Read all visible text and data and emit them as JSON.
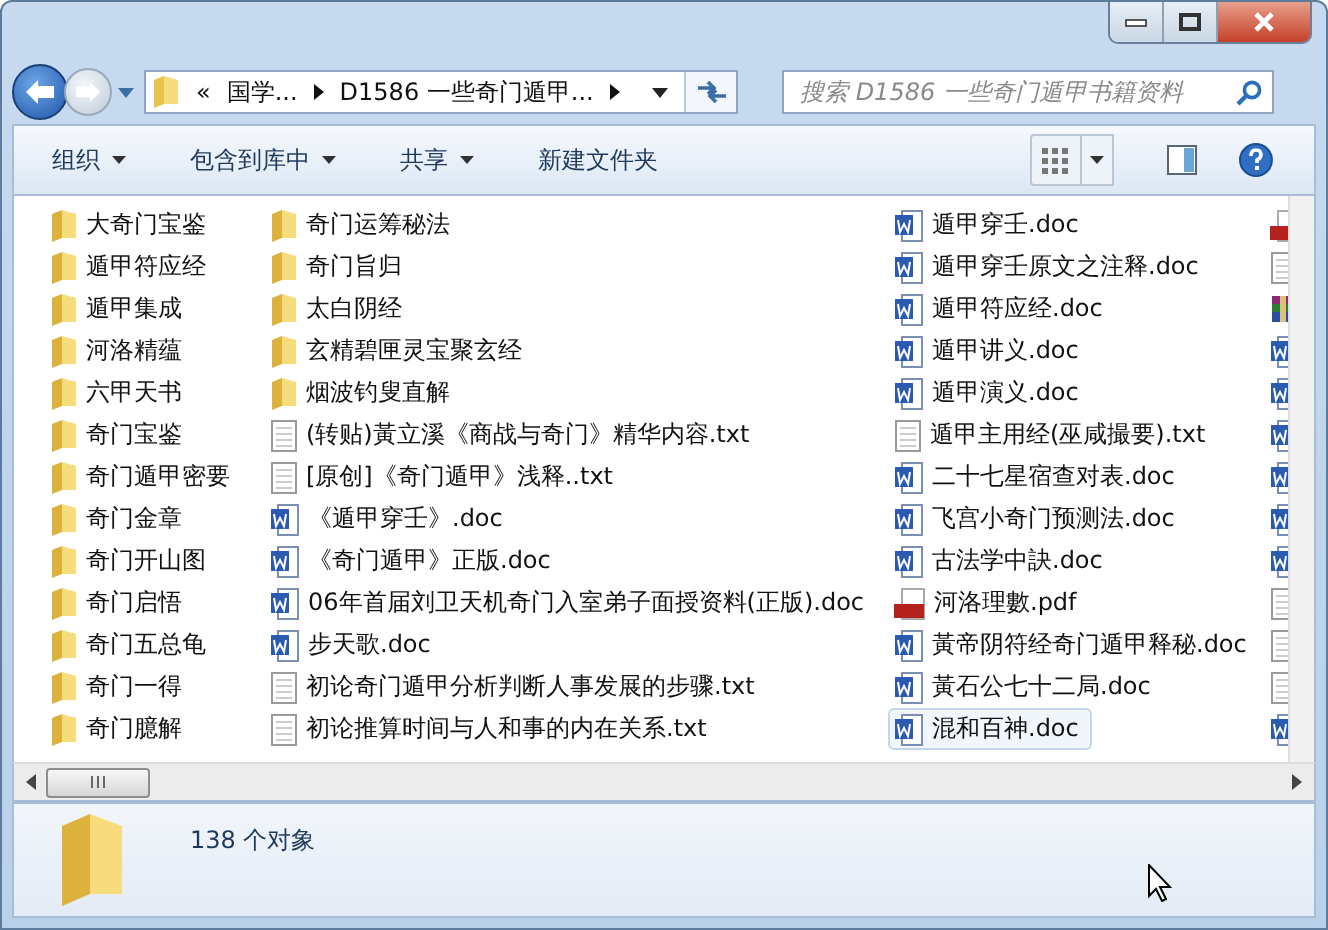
{
  "address": {
    "overflow": "«",
    "crumbs": [
      "国学...",
      "D1586 一些奇门遁甲..."
    ]
  },
  "search": {
    "placeholder": "搜索 D1586 一些奇门遁甲书籍资料"
  },
  "toolbar": [
    {
      "label": "组织",
      "menu": true
    },
    {
      "label": "包含到库中",
      "menu": true
    },
    {
      "label": "共享",
      "menu": true
    },
    {
      "label": "新建文件夹",
      "menu": false
    }
  ],
  "columns": [
    {
      "items": [
        {
          "kind": "folder",
          "name": "大奇门宝鉴",
          "selected": false
        },
        {
          "kind": "folder",
          "name": "遁甲符应经",
          "selected": false
        },
        {
          "kind": "folder",
          "name": "遁甲集成",
          "selected": false
        },
        {
          "kind": "folder",
          "name": "河洛精蕴",
          "selected": false
        },
        {
          "kind": "folder",
          "name": "六甲天书",
          "selected": false
        },
        {
          "kind": "folder",
          "name": "奇门宝鉴",
          "selected": false
        },
        {
          "kind": "folder",
          "name": "奇门遁甲密要",
          "selected": false
        },
        {
          "kind": "folder",
          "name": "奇门金章",
          "selected": false
        },
        {
          "kind": "folder",
          "name": "奇门开山图",
          "selected": false
        },
        {
          "kind": "folder",
          "name": "奇门启悟",
          "selected": false
        },
        {
          "kind": "folder",
          "name": "奇门五总龟",
          "selected": false
        },
        {
          "kind": "folder",
          "name": "奇门一得",
          "selected": false
        },
        {
          "kind": "folder",
          "name": "奇门臆解",
          "selected": false
        }
      ]
    },
    {
      "items": [
        {
          "kind": "folder",
          "name": "奇门运筹秘法",
          "selected": false
        },
        {
          "kind": "folder",
          "name": "奇门旨归",
          "selected": false
        },
        {
          "kind": "folder",
          "name": "太白阴经",
          "selected": false
        },
        {
          "kind": "folder",
          "name": "玄精碧匣灵宝聚玄经",
          "selected": false
        },
        {
          "kind": "folder",
          "name": "烟波钓叟直解",
          "selected": false
        },
        {
          "kind": "txt",
          "name": "(转贴)黃立溪《商战与奇门》精华内容.txt",
          "selected": false
        },
        {
          "kind": "txt",
          "name": "[原创]《奇门遁甲》浅释..txt",
          "selected": false
        },
        {
          "kind": "doc",
          "name": "《遁甲穿壬》.doc",
          "selected": false
        },
        {
          "kind": "doc",
          "name": "《奇门遁甲》正版.doc",
          "selected": false
        },
        {
          "kind": "doc",
          "name": "06年首届刘卫天机奇门入室弟子面授资料(正版).doc",
          "selected": false
        },
        {
          "kind": "doc",
          "name": "步天歌.doc",
          "selected": false
        },
        {
          "kind": "txt",
          "name": "初论奇门遁甲分析判断人事发展的步骤.txt",
          "selected": false
        },
        {
          "kind": "txt",
          "name": "初论推算时间与人和事的内在关系.txt",
          "selected": false
        }
      ]
    },
    {
      "items": [
        {
          "kind": "doc",
          "name": "遁甲穿壬.doc",
          "selected": false
        },
        {
          "kind": "doc",
          "name": "遁甲穿壬原文之注释.doc",
          "selected": false
        },
        {
          "kind": "doc",
          "name": "遁甲符应经.doc",
          "selected": false
        },
        {
          "kind": "doc",
          "name": "遁甲讲义.doc",
          "selected": false
        },
        {
          "kind": "doc",
          "name": "遁甲演义.doc",
          "selected": false
        },
        {
          "kind": "txt",
          "name": "遁甲主用经(巫咸撮要).txt",
          "selected": false
        },
        {
          "kind": "doc",
          "name": "二十七星宿查对表.doc",
          "selected": false
        },
        {
          "kind": "doc",
          "name": "飞宫小奇门预测法.doc",
          "selected": false
        },
        {
          "kind": "doc",
          "name": "古法学中訣.doc",
          "selected": false
        },
        {
          "kind": "pdf",
          "name": "河洛理數.pdf",
          "selected": false
        },
        {
          "kind": "doc",
          "name": "黃帝阴符经奇门遁甲释秘.doc",
          "selected": false
        },
        {
          "kind": "doc",
          "name": "黃石公七十二局.doc",
          "selected": false
        },
        {
          "kind": "doc",
          "name": "混和百神.doc",
          "selected": true
        }
      ]
    },
    {
      "items": [
        {
          "kind": "pdf"
        },
        {
          "kind": "txt"
        },
        {
          "kind": "rar"
        },
        {
          "kind": "doc"
        },
        {
          "kind": "doc"
        },
        {
          "kind": "doc"
        },
        {
          "kind": "doc"
        },
        {
          "kind": "doc"
        },
        {
          "kind": "doc"
        },
        {
          "kind": "txt"
        },
        {
          "kind": "txt"
        },
        {
          "kind": "txt"
        },
        {
          "kind": "doc"
        }
      ]
    }
  ],
  "status": {
    "count": "138 个对象"
  }
}
